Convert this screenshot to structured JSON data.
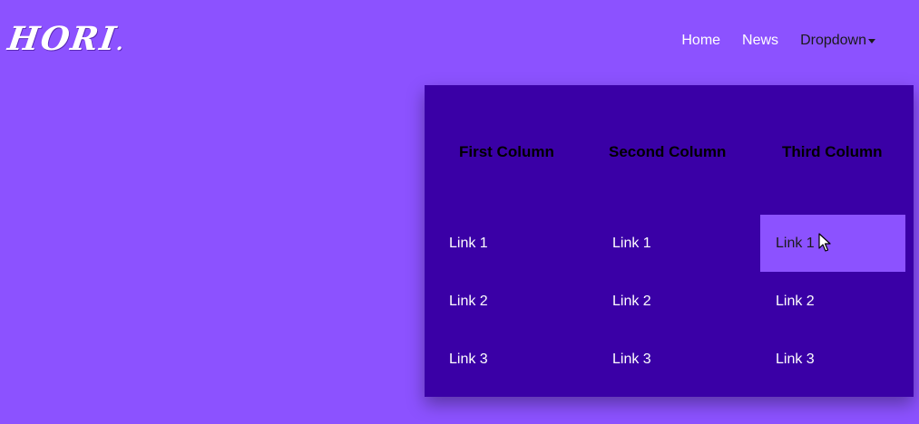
{
  "logo": {
    "text": "HORI",
    "dot": "."
  },
  "nav": {
    "home": "Home",
    "news": "News",
    "dropdown": "Dropdown",
    "caret_icon": "caret-down-icon"
  },
  "dropdown": {
    "columns": [
      {
        "header": "First Column",
        "links": [
          "Link 1",
          "Link 2",
          "Link 3"
        ]
      },
      {
        "header": "Second Column",
        "links": [
          "Link 1",
          "Link 2",
          "Link 3"
        ]
      },
      {
        "header": "Third Column",
        "links": [
          "Link 1",
          "Link 2",
          "Link 3"
        ]
      }
    ],
    "hovered": {
      "column": 3,
      "link": 1
    }
  },
  "cursor_icon": "mouse-pointer-icon",
  "colors": {
    "page_bg": "#8c52ff",
    "panel_bg": "#3a00a6",
    "hover_bg": "#8c52ff",
    "text_light": "#ffffff",
    "text_dark": "#000000"
  }
}
